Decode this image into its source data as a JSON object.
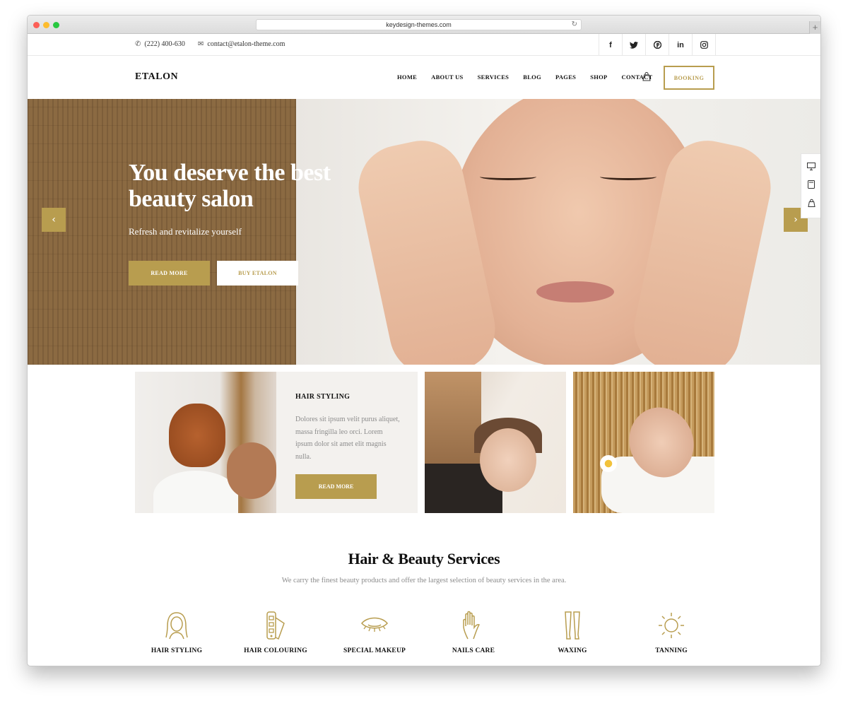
{
  "browser": {
    "url": "keydesign-themes.com"
  },
  "topbar": {
    "phone": "(222) 400-630",
    "email": "contact@etalon-theme.com",
    "socials": [
      "f",
      "t",
      "p",
      "in",
      "ig"
    ]
  },
  "nav": {
    "logo": "ETALON",
    "items": [
      "HOME",
      "ABOUT US",
      "SERVICES",
      "BLOG",
      "PAGES",
      "SHOP",
      "CONTACT"
    ],
    "booking": "BOOKING"
  },
  "hero": {
    "title": "You deserve the best beauty salon",
    "subtitle": "Refresh and revitalize yourself",
    "btn_read_more": "READ MORE",
    "btn_buy": "BUY ETALON"
  },
  "feature": {
    "title": "HAIR STYLING",
    "text": "Dolores sit ipsum velit purus aliquet, massa fringilla leo orci. Lorem ipsum dolor sit amet elit magnis nulla.",
    "button": "READ MORE"
  },
  "services": {
    "title": "Hair & Beauty Services",
    "subtitle": "We carry the finest beauty products and offer the largest selection of beauty services in the area.",
    "items": [
      "HAIR STYLING",
      "HAIR COLOURING",
      "SPECIAL MAKEUP",
      "NAILS CARE",
      "WAXING",
      "TANNING"
    ]
  },
  "colors": {
    "accent": "#b89d4f",
    "text": "#1e1e1e",
    "muted": "#8c8c8c"
  }
}
